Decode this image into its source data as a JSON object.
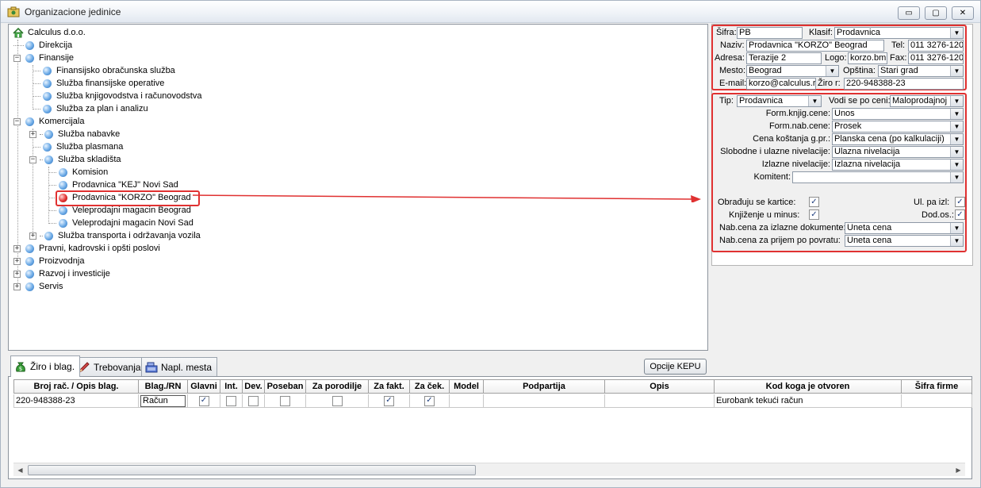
{
  "window": {
    "title": "Organizacione jedinice",
    "buttons": {
      "minimize": "▭",
      "maximize": "▢",
      "close": "✕"
    }
  },
  "tree": {
    "root": "Calculus d.o.o.",
    "items": [
      "Direkcija",
      "Finansije",
      "Finansijsko obračunska služba",
      "Služba finansijske operative",
      "Služba knjigovodstva i računovodstva",
      "Služba za plan i analizu",
      "Komercijala",
      "Služba nabavke",
      "Služba plasmana",
      "Služba skladišta",
      "Komision",
      "Prodavnica \"KEJ\" Novi Sad",
      "Prodavnica \"KORZO\" Beograd",
      "Veleprodajni magacin Beograd",
      "Veleprodajni magacin Novi Sad",
      "Služba transporta i održavanja vozila",
      "Pravni, kadrovski i opšti poslovi",
      "Proizvodnja",
      "Razvoj i investicije",
      "Servis"
    ],
    "expander_plus": "+",
    "expander_minus": "−"
  },
  "details": {
    "sifra_label": "Šifra:",
    "sifra": "PB",
    "klasif_label": "Klasif:",
    "klasif": "Prodavnica",
    "naziv_label": "Naziv:",
    "naziv": "Prodavnica \"KORZO\" Beograd",
    "tel_label": "Tel:",
    "tel": "011 3276-120",
    "adresa_label": "Adresa:",
    "adresa": "Terazije 2",
    "logo_label": "Logo:",
    "logo": "korzo.bmp",
    "fax_label": "Fax:",
    "fax": "011 3276-120",
    "mesto_label": "Mesto:",
    "mesto": "Beograd",
    "opstina_label": "Opština:",
    "opstina": "Stari grad",
    "email_label": "E-mail:",
    "email": "korzo@calculus.rs",
    "ziro_label": "Žiro r:",
    "ziro": "220-948388-23"
  },
  "settings": {
    "tip_label": "Tip:",
    "tip": "Prodavnica",
    "vodi_label": "Vodi se po ceni:",
    "vodi": "Maloprodajnoj",
    "form_knjig_label": "Form.knjig.cene:",
    "form_knjig": "Unos",
    "form_nab_label": "Form.nab.cene:",
    "form_nab": "Prosek",
    "cena_kost_label": "Cena koštanja g.pr.:",
    "cena_kost": "Planska cena (po kalkulaciji)",
    "slobodne_label": "Slobodne i ulazne nivelacije:",
    "slobodne": "Ulazna nivelacija",
    "izlazne_label": "Izlazne nivelacije:",
    "izlazne": "Izlazna nivelacija",
    "komitent_label": "Komitent:",
    "komitent": "",
    "obradjuju_label": "Obrađuju se kartice:",
    "ul_pa_izl_label": "Ul. pa izl:",
    "knjizenje_label": "Knjiženje u minus:",
    "dod_os_label": "Dod.os.:",
    "nab_izl_label": "Nab.cena za izlazne dokumente:",
    "nab_izl": "Uneta cena",
    "nab_prijem_label": "Nab.cena za prijem po povratu:",
    "nab_prijem": "Uneta cena"
  },
  "tabs": [
    "Žiro i blag.",
    "Trebovanja",
    "Napl. mesta"
  ],
  "opcije_button": "Opcije KEPU",
  "grid": {
    "columns": [
      "Broj rač. / Opis blag.",
      "Blag./RN",
      "Glavni",
      "Int.",
      "Dev.",
      "Poseban",
      "Za porodilje",
      "Za fakt.",
      "Za ček.",
      "Model",
      "Podpartija",
      "Opis",
      "Kod koga je otvoren",
      "Šifra firme"
    ],
    "rows": [
      {
        "broj": "220-948388-23",
        "blag": "Račun",
        "banka": "Eurobank tekući račun"
      }
    ]
  },
  "colors": {
    "highlight": "#e03131",
    "accent": "#2f6fb6"
  }
}
